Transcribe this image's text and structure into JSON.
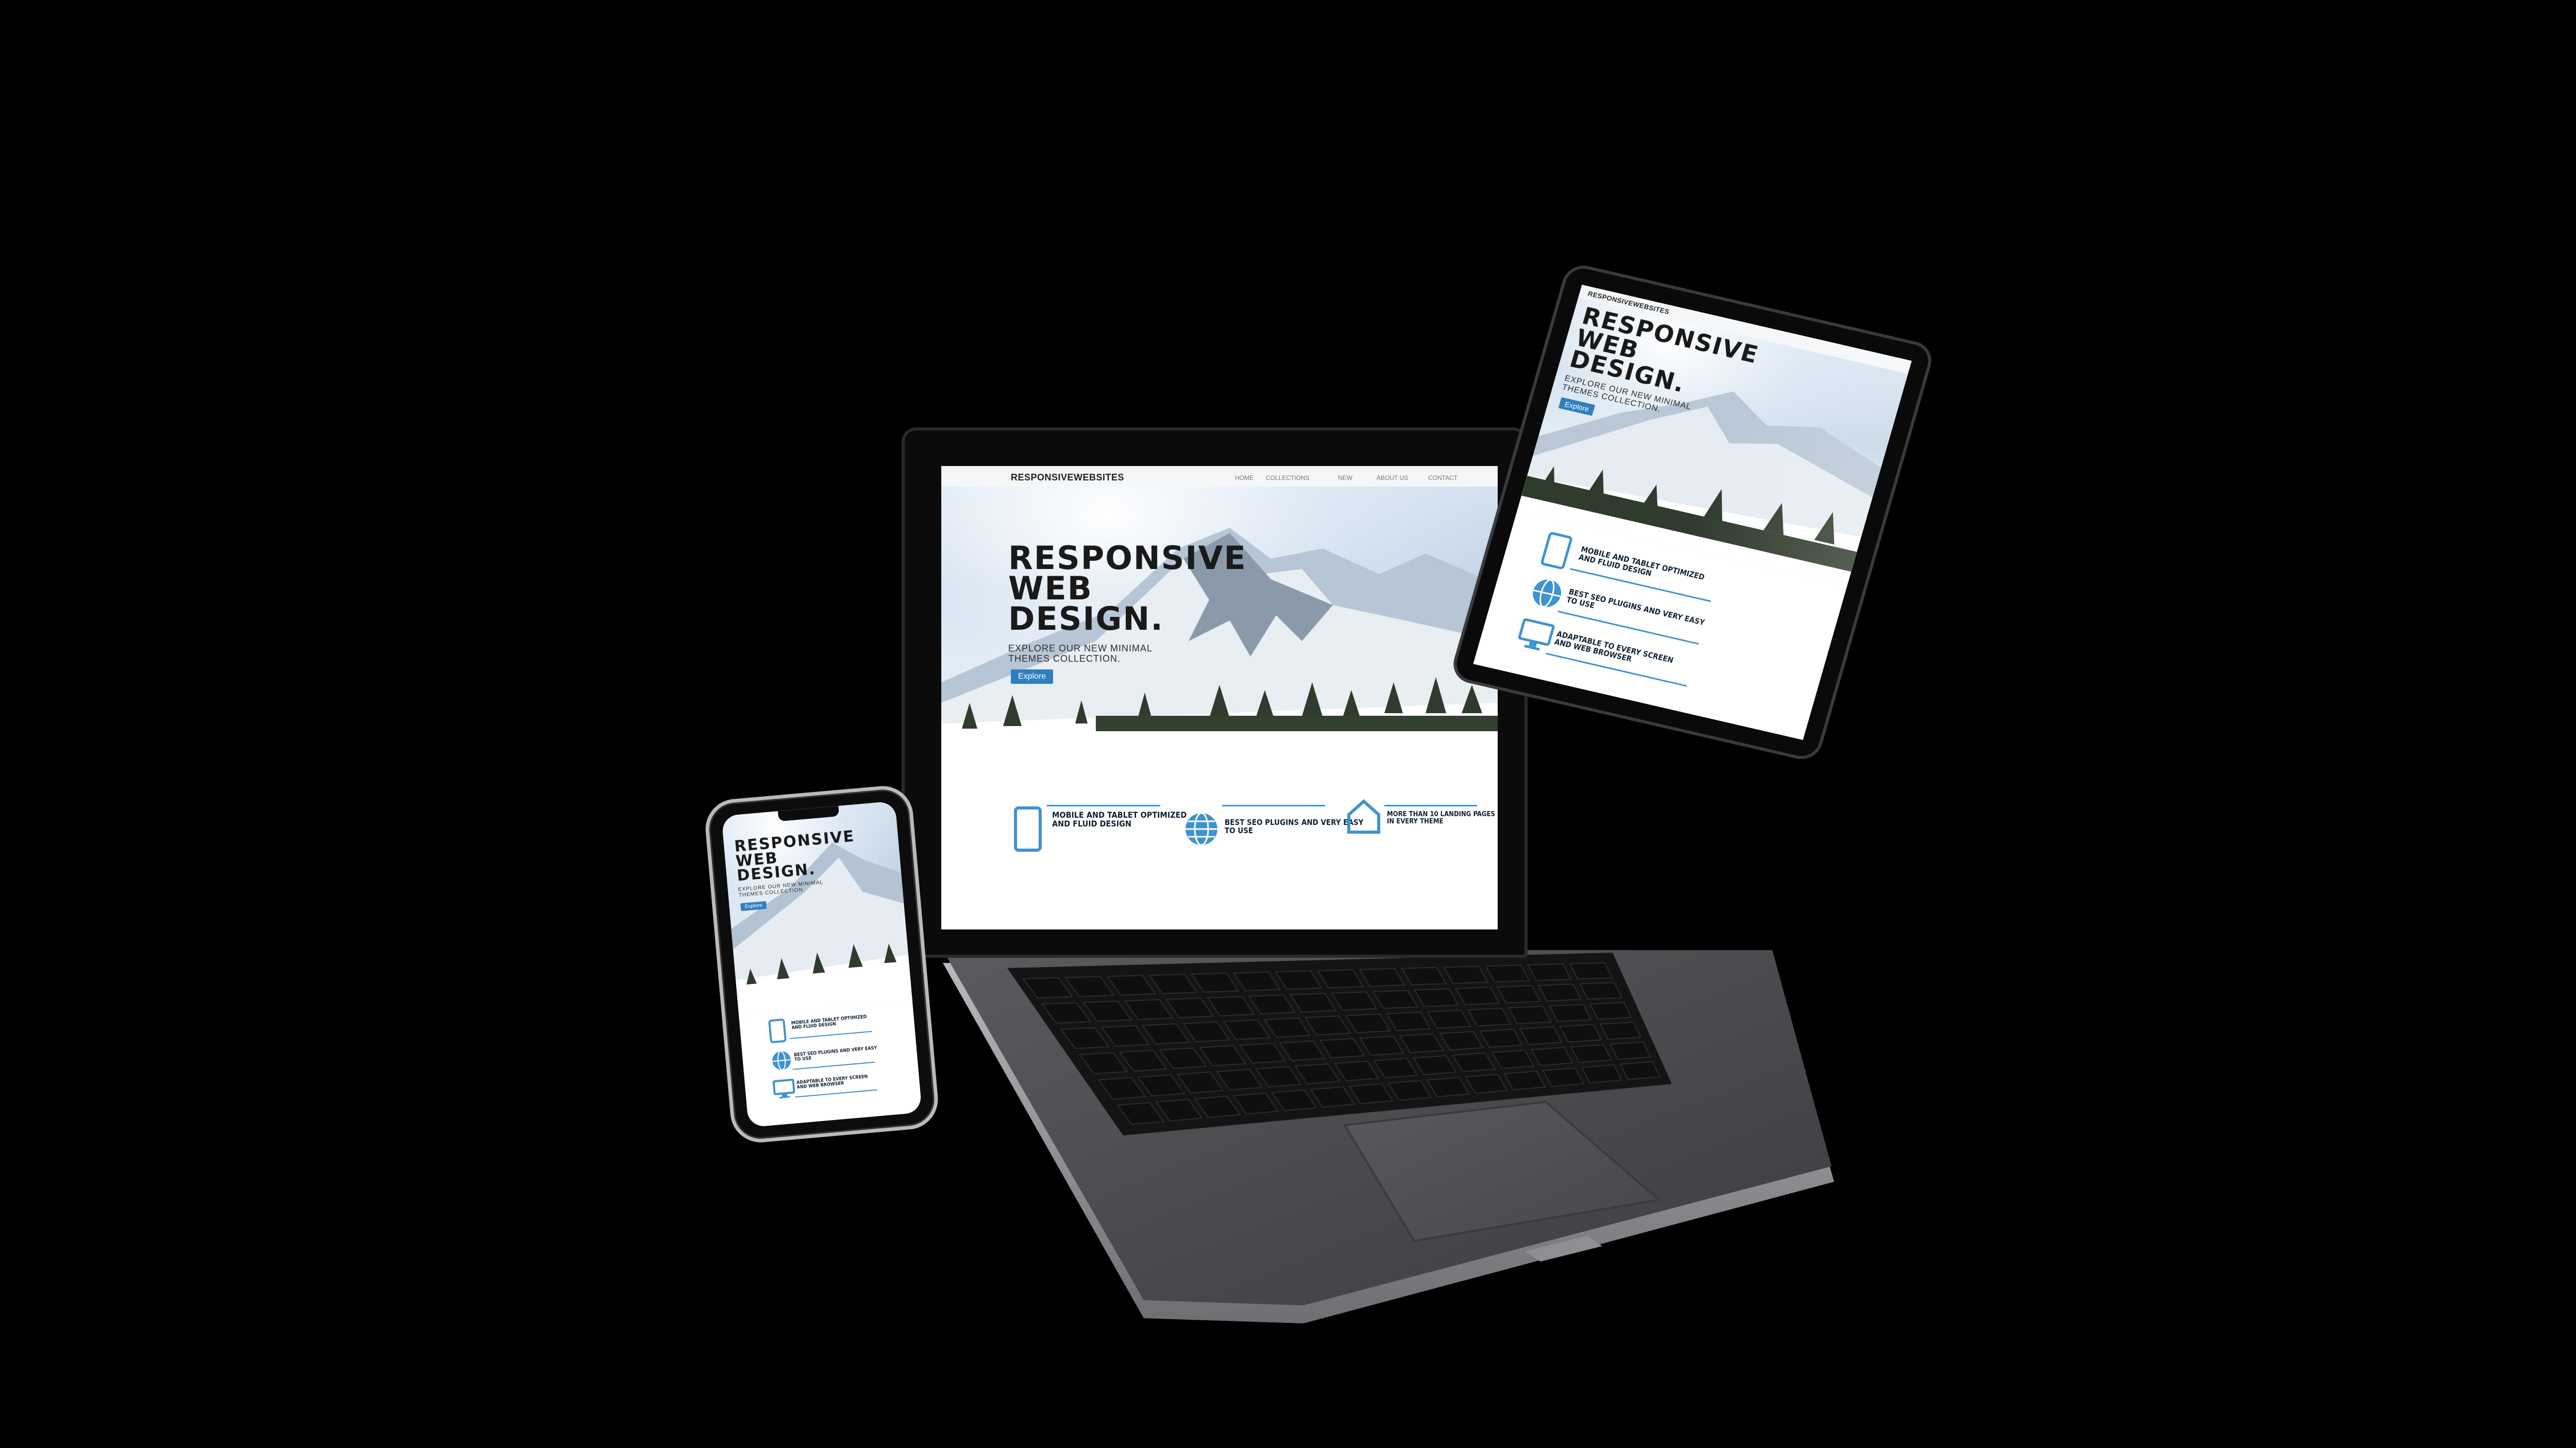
{
  "colors": {
    "background": "#000000",
    "accent": "#3f93d0",
    "button": "#2f7fc0",
    "laptop_body": "#4a4b4d",
    "bezel": "#0c0c0c"
  },
  "laptop": {
    "logo": "RESPONSIVEWEBSITES",
    "nav": [
      "HOME",
      "COLLECTIONS",
      "NEW",
      "ABOUT US",
      "CONTACT"
    ],
    "hero_title_lines": [
      "RESPONSIVE",
      "WEB",
      "DESIGN."
    ],
    "hero_sub_lines": [
      "EXPLORE OUR NEW MINIMAL",
      "THEMES COLLECTION."
    ],
    "button": "Explore",
    "features": [
      {
        "icon": "tablet-icon",
        "text_lines": [
          "MOBILE AND TABLET OPTIMIZED",
          "AND FLUID DESIGN"
        ]
      },
      {
        "icon": "globe-icon",
        "text_lines": [
          "BEST SEO PLUGINS AND VERY EASY",
          "TO USE"
        ]
      },
      {
        "icon": "house-icon",
        "text_lines": [
          "MORE THAN 10 LANDING PAGES",
          "IN EVERY THEME"
        ]
      }
    ]
  },
  "tablet": {
    "logo": "RESPONSIVEWEBSITES",
    "hero_title_lines": [
      "RESPONSIVE",
      "WEB",
      "DESIGN."
    ],
    "hero_sub_lines": [
      "EXPLORE OUR NEW MINIMAL",
      "THEMES COLLECTION."
    ],
    "button": "Explore",
    "features": [
      {
        "icon": "tablet-icon",
        "text_lines": [
          "MOBILE AND TABLET OPTIMIZED",
          "AND FLUID DESIGN"
        ]
      },
      {
        "icon": "globe-icon",
        "text_lines": [
          "BEST SEO PLUGINS AND VERY EASY",
          "TO USE"
        ]
      },
      {
        "icon": "monitor-icon",
        "text_lines": [
          "ADAPTABLE TO EVERY SCREEN",
          "AND WEB BROWSER"
        ]
      }
    ]
  },
  "phone": {
    "hero_title_lines": [
      "RESPONSIVE",
      "WEB",
      "DESIGN."
    ],
    "hero_sub_lines": [
      "EXPLORE OUR NEW MINIMAL",
      "THEMES COLLECTION."
    ],
    "button": "Explore",
    "features": [
      {
        "icon": "tablet-icon",
        "text_lines": [
          "MOBILE AND TABLET OPTIMIZED",
          "AND FLUID DESIGN"
        ]
      },
      {
        "icon": "globe-icon",
        "text_lines": [
          "BEST SEO PLUGINS AND VERY EASY",
          "TO USE"
        ]
      },
      {
        "icon": "monitor-icon",
        "text_lines": [
          "ADAPTABLE TO EVERY SCREEN",
          "AND WEB BROWSER"
        ]
      }
    ]
  }
}
